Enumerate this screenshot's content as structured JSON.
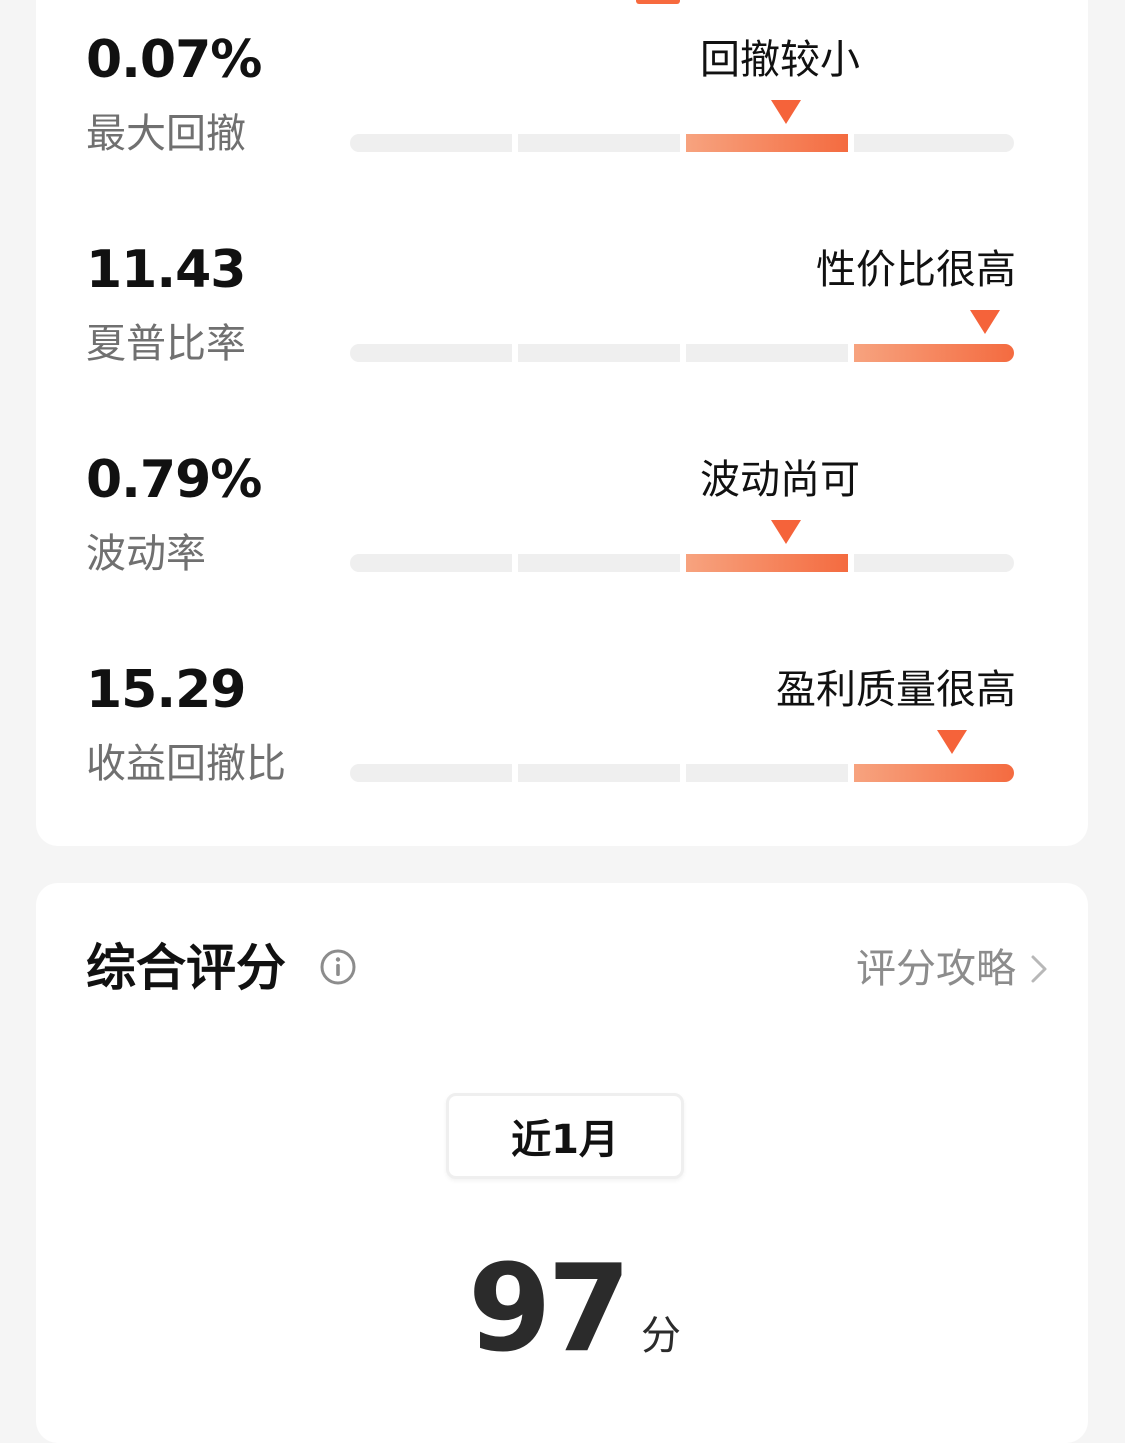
{
  "metrics": [
    {
      "value": "0.07%",
      "label": "最大回撤",
      "status": "回撤较小",
      "level_segment": 3,
      "level_of": 4
    },
    {
      "value": "11.43",
      "label": "夏普比率",
      "status": "性价比很高",
      "level_segment": 4,
      "level_of": 4
    },
    {
      "value": "0.79%",
      "label": "波动率",
      "status": "波动尚可",
      "level_segment": 3,
      "level_of": 4
    },
    {
      "value": "15.29",
      "label": "收益回撤比",
      "status": "盈利质量很高",
      "level_segment": 4,
      "level_of": 4
    }
  ],
  "score_section": {
    "title": "综合评分",
    "guide_link": "评分攻略",
    "period": "近1月",
    "score": "97",
    "score_unit": "分"
  },
  "colors": {
    "accent": "#f46b40",
    "accent_light": "#f7a37f",
    "track": "#efefef",
    "background": "#f5f5f5"
  },
  "icons": {
    "info": "info-icon",
    "chevron": "chevron-right-icon",
    "pointer": "triangle-down-icon"
  }
}
